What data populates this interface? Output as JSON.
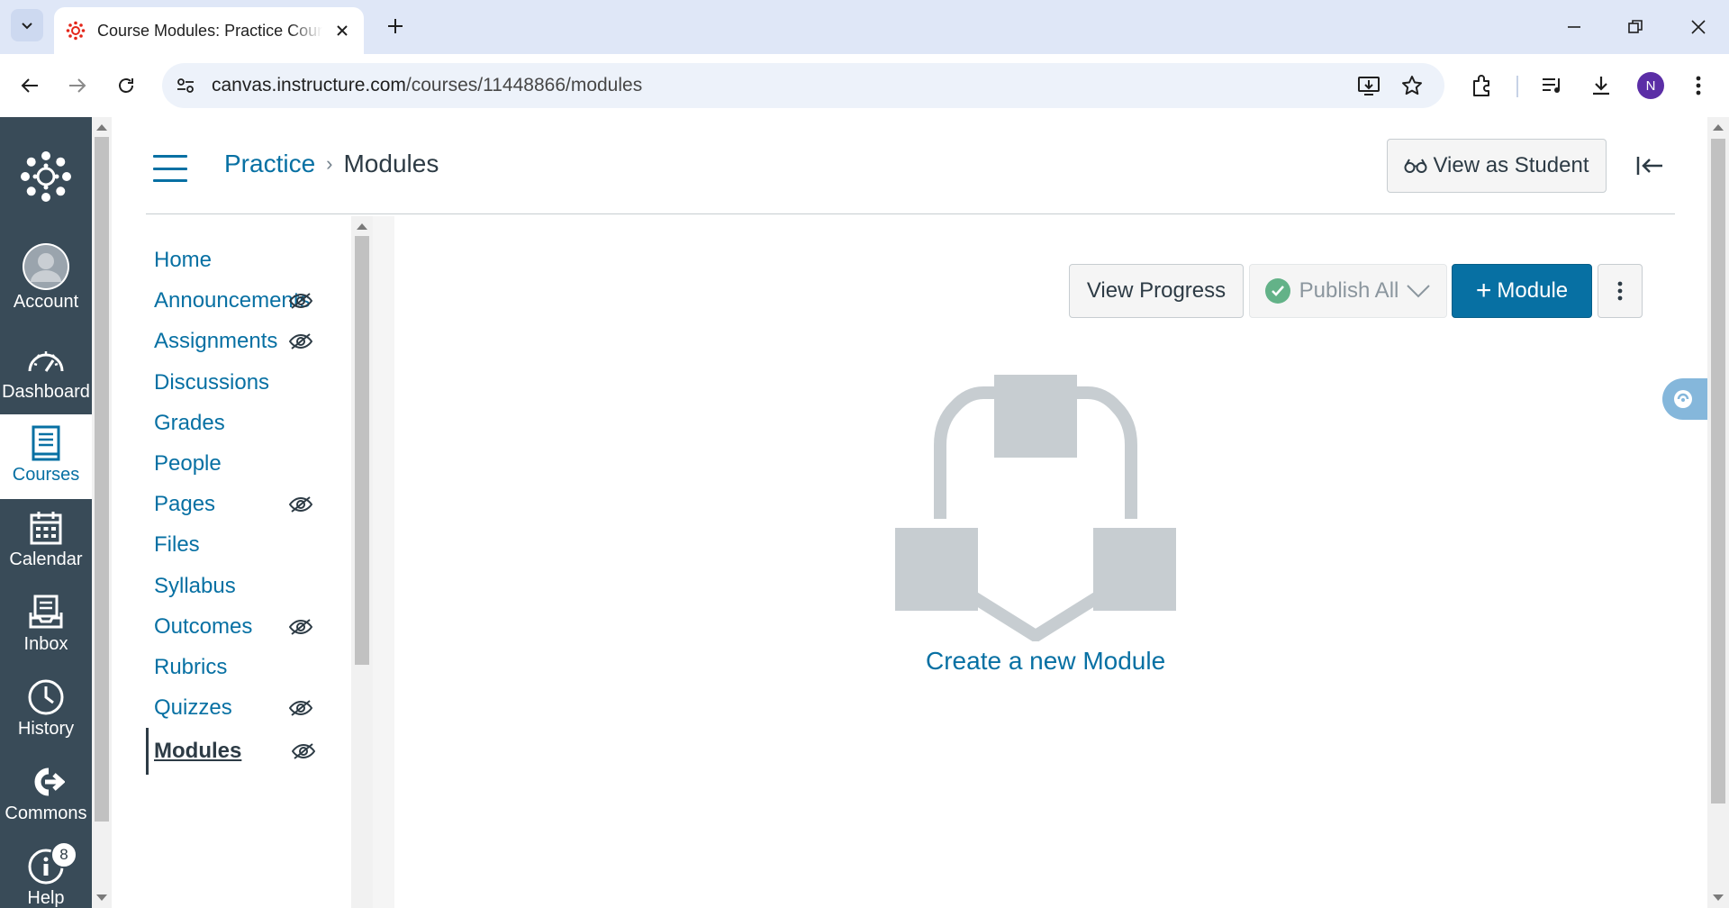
{
  "browser": {
    "tab_title": "Course Modules: Practice Course",
    "url_host": "canvas.instructure.com",
    "url_path": "/courses/11448866/modules",
    "profile_initial": "N",
    "accent_color": "#dfe7f7"
  },
  "global_nav": {
    "items": [
      {
        "label": "Account",
        "icon": "account-icon"
      },
      {
        "label": "Dashboard",
        "icon": "dashboard-icon"
      },
      {
        "label": "Courses",
        "icon": "courses-icon",
        "active": true
      },
      {
        "label": "Calendar",
        "icon": "calendar-icon"
      },
      {
        "label": "Inbox",
        "icon": "inbox-icon"
      },
      {
        "label": "History",
        "icon": "history-icon"
      },
      {
        "label": "Commons",
        "icon": "commons-icon"
      },
      {
        "label": "Help",
        "icon": "help-icon",
        "badge": "8"
      }
    ],
    "background": "#394b58"
  },
  "header": {
    "breadcrumb_course": "Practice",
    "breadcrumb_sep": "›",
    "breadcrumb_current": "Modules",
    "view_as_student": "View as Student"
  },
  "course_nav": {
    "items": [
      {
        "label": "Home",
        "hidden": false
      },
      {
        "label": "Announcements",
        "hidden": true
      },
      {
        "label": "Assignments",
        "hidden": true
      },
      {
        "label": "Discussions",
        "hidden": false
      },
      {
        "label": "Grades",
        "hidden": false
      },
      {
        "label": "People",
        "hidden": false
      },
      {
        "label": "Pages",
        "hidden": true
      },
      {
        "label": "Files",
        "hidden": false
      },
      {
        "label": "Syllabus",
        "hidden": false
      },
      {
        "label": "Outcomes",
        "hidden": true
      },
      {
        "label": "Rubrics",
        "hidden": false
      },
      {
        "label": "Quizzes",
        "hidden": true
      },
      {
        "label": "Modules",
        "hidden": true,
        "active": true
      }
    ]
  },
  "toolbar": {
    "view_progress": "View Progress",
    "publish_all": "Publish All",
    "add_module": "Module",
    "add_module_plus": "+"
  },
  "empty_state": {
    "create_link": "Create a new Module"
  },
  "colors": {
    "link": "#0770a3",
    "primary_button": "#0770a3",
    "publish_check": "#63b288"
  }
}
